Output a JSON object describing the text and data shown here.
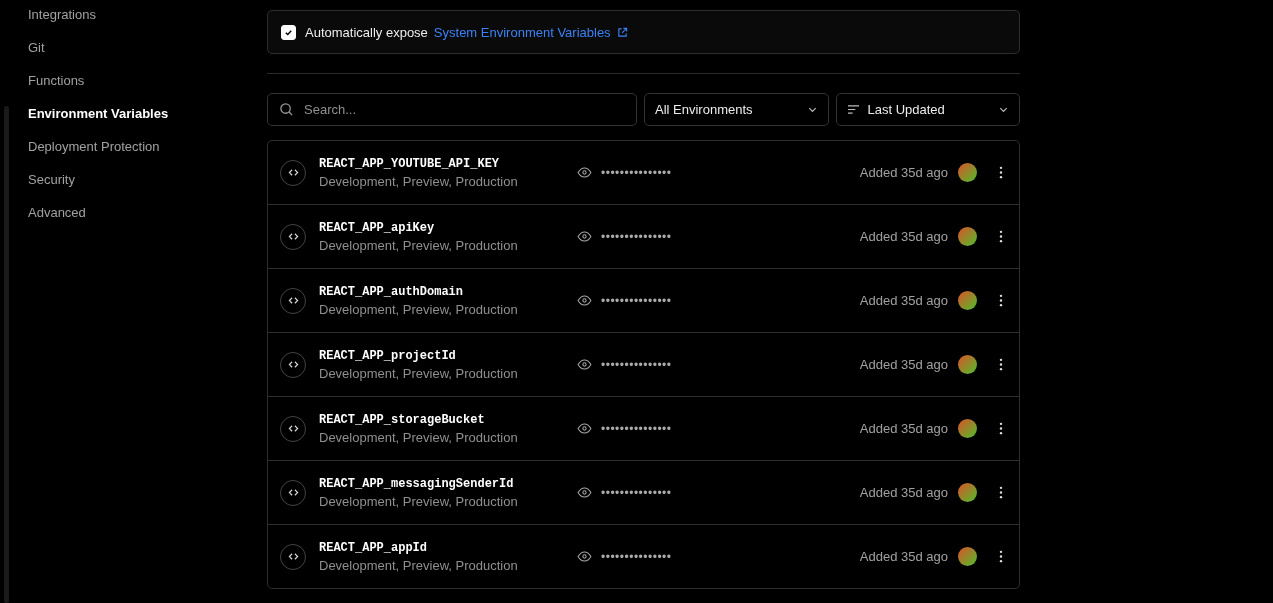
{
  "sidebar": {
    "items": [
      {
        "label": "Integrations",
        "selected": false
      },
      {
        "label": "Git",
        "selected": false
      },
      {
        "label": "Functions",
        "selected": false
      },
      {
        "label": "Environment Variables",
        "selected": true
      },
      {
        "label": "Deployment Protection",
        "selected": false
      },
      {
        "label": "Security",
        "selected": false
      },
      {
        "label": "Advanced",
        "selected": false
      }
    ]
  },
  "expose": {
    "checked": true,
    "label": "Automatically expose",
    "link": "System Environment Variables"
  },
  "search": {
    "placeholder": "Search..."
  },
  "environment_filter": "All Environments",
  "sort": "Last Updated",
  "variables": [
    {
      "name": "REACT_APP_YOUTUBE_API_KEY",
      "environments": "Development, Preview, Production",
      "value": "•••••••••••••••",
      "added": "Added 35d ago"
    },
    {
      "name": "REACT_APP_apiKey",
      "environments": "Development, Preview, Production",
      "value": "•••••••••••••••",
      "added": "Added 35d ago"
    },
    {
      "name": "REACT_APP_authDomain",
      "environments": "Development, Preview, Production",
      "value": "•••••••••••••••",
      "added": "Added 35d ago"
    },
    {
      "name": "REACT_APP_projectId",
      "environments": "Development, Preview, Production",
      "value": "•••••••••••••••",
      "added": "Added 35d ago"
    },
    {
      "name": "REACT_APP_storageBucket",
      "environments": "Development, Preview, Production",
      "value": "•••••••••••••••",
      "added": "Added 35d ago"
    },
    {
      "name": "REACT_APP_messagingSenderId",
      "environments": "Development, Preview, Production",
      "value": "•••••••••••••••",
      "added": "Added 35d ago"
    },
    {
      "name": "REACT_APP_appId",
      "environments": "Development, Preview, Production",
      "value": "•••••••••••••••",
      "added": "Added 35d ago"
    }
  ]
}
